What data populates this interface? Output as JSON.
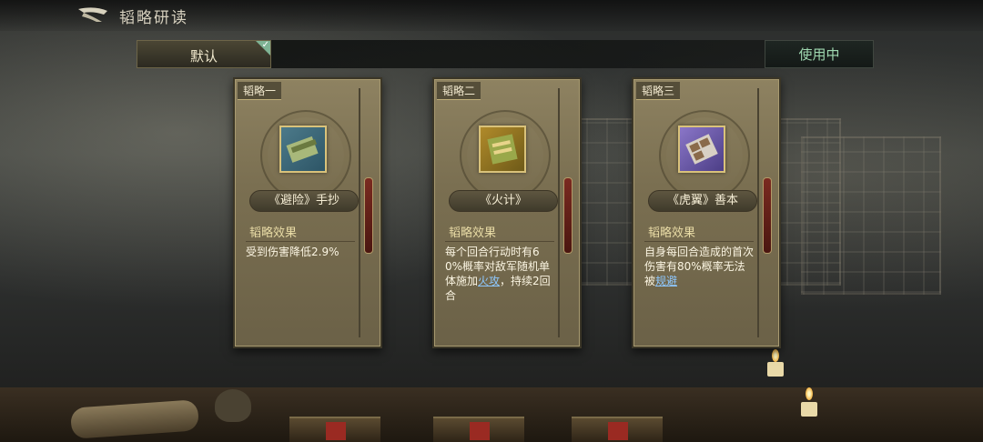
{
  "header": {
    "title": "韬略研读"
  },
  "tabs": {
    "default_label": "默认",
    "status_label": "使用中"
  },
  "cards": [
    {
      "tag": "韬略一",
      "name": "《避险》手抄",
      "effect_title": "韬略效果",
      "effect_text": "受到伤害降低2.9%",
      "icon": "book-scroll-icon"
    },
    {
      "tag": "韬略二",
      "name": "《火计》",
      "effect_title": "韬略效果",
      "effect_text_before": "每个回合行动时有60%概率对敌军随机单体施加",
      "effect_keyword": "火攻",
      "effect_text_after": "，持续2回合",
      "icon": "fire-scroll-icon"
    },
    {
      "tag": "韬略三",
      "name": "《虎翼》善本",
      "effect_title": "韬略效果",
      "effect_text_before": "自身每回合造成的首次伤害有80%概率无法被",
      "effect_keyword": "规避",
      "effect_text_after": "",
      "icon": "tiger-book-icon"
    }
  ],
  "colors": {
    "card_bg": "#7a6f51",
    "status_text": "#9fd8b0",
    "keyword": "#8ec8ff"
  }
}
